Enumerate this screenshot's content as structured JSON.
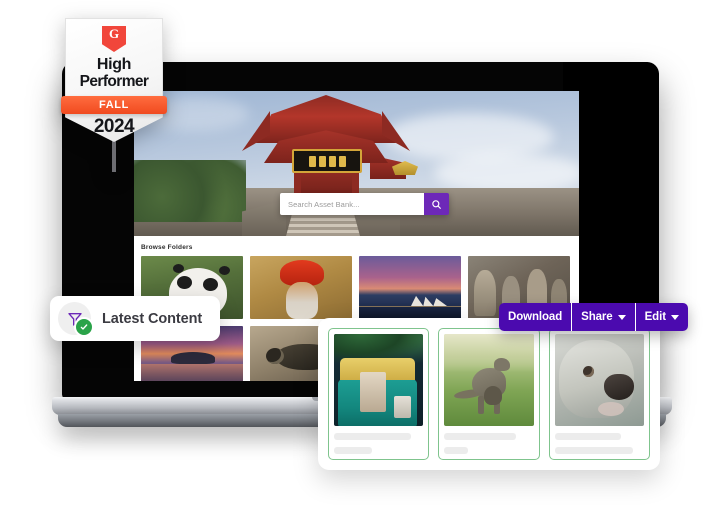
{
  "badge": {
    "logo_text": "G",
    "logo_name": "g2-logo-icon",
    "line1": "High",
    "line2": "Performer",
    "season": "FALL",
    "year": "2024",
    "colors": {
      "ribbon": "#f04a1f",
      "logo": "#f1463b",
      "text": "#15161a"
    }
  },
  "browser": {
    "search": {
      "placeholder": "Search Asset Bank...",
      "value": "",
      "button_icon": "search-icon",
      "button_color": "#6d28b8"
    },
    "hero": {
      "alt": "chinese-pagoda-temple"
    },
    "section": {
      "title": "Browse Folders"
    },
    "thumbnails_row1": [
      {
        "alt": "giant-panda"
      },
      {
        "alt": "indian-sadhu-red-turban"
      },
      {
        "alt": "sydney-opera-house-dusk"
      },
      {
        "alt": "terracotta-warriors"
      }
    ],
    "thumbnails_row2": [
      {
        "alt": "sunset-lake-island"
      },
      {
        "alt": "insect-macro"
      }
    ]
  },
  "pill": {
    "label": "Latest Content",
    "icon": "filter-funnel-icon",
    "status_icon": "check-circle-icon",
    "colors": {
      "funnel": "#6d28b8",
      "check": "#2aa349"
    }
  },
  "actions": {
    "color": "#4b0aaf",
    "buttons": [
      {
        "label": "Download",
        "has_caret": false
      },
      {
        "label": "Share",
        "has_caret": true
      },
      {
        "label": "Edit",
        "has_caret": true
      }
    ]
  },
  "panel": {
    "cards": [
      {
        "alt": "green-tuk-tuk-auto-rickshaw",
        "lines": [
          86,
          42
        ]
      },
      {
        "alt": "kangaroo-with-joey",
        "lines": [
          80,
          26
        ]
      },
      {
        "alt": "koala-close-up",
        "lines": [
          74,
          88
        ]
      }
    ],
    "border_color": "#7fc48d"
  }
}
